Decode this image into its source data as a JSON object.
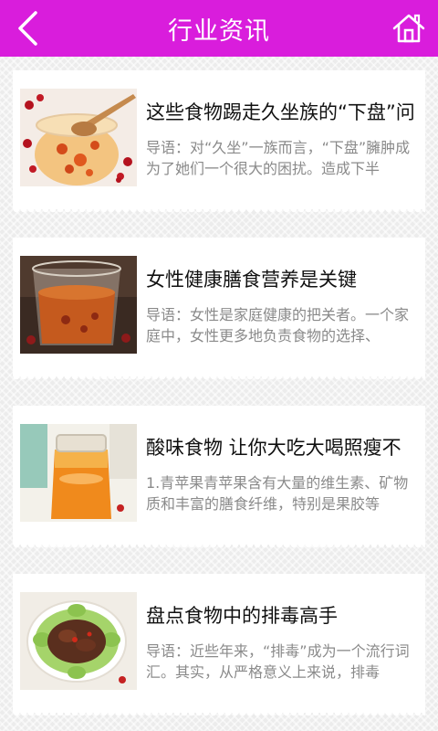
{
  "header": {
    "title": "行业资讯",
    "back_icon": "chevron-left-icon",
    "home_icon": "home-icon",
    "bar_color": "#d91ddc"
  },
  "articles": [
    {
      "title": "这些食物踢走久坐族的“下盘”问",
      "summary": "导语：对“久坐”一族而言，“下盘”臃肿成为了她们一个很大的困扰。造成下半"
    },
    {
      "title": "女性健康膳食营养是关键",
      "summary": "导语：女性是家庭健康的把关者。一个家庭中，女性更多地负责食物的选择、"
    },
    {
      "title": "酸味食物 让你大吃大喝照瘦不",
      "summary": "1.青苹果青苹果含有大量的维生素、矿物质和丰富的膳食纤维，特别是果胶等"
    },
    {
      "title": "盘点食物中的排毒高手",
      "summary": "导语：近些年来，“排毒”成为一个流行词汇。其实，从严格意义上来说，排毒"
    }
  ]
}
